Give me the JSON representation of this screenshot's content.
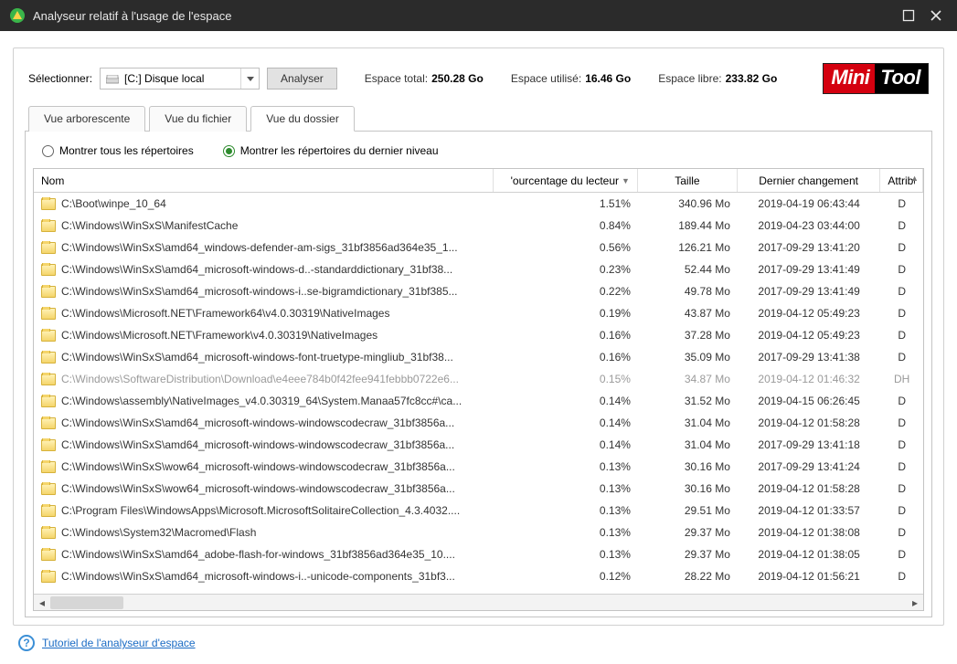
{
  "window": {
    "title": "Analyseur relatif à l'usage de l'espace"
  },
  "toolbar": {
    "select_label": "Sélectionner:",
    "drive_text": "[C:] Disque local",
    "analyze": "Analyser",
    "stats": {
      "total_label": "Espace total:",
      "total_value": "250.28 Go",
      "used_label": "Espace utilisé:",
      "used_value": "16.46 Go",
      "free_label": "Espace libre:",
      "free_value": "233.82 Go"
    },
    "logo_red": "Mini",
    "logo_black": "Tool"
  },
  "tabs": {
    "tree": "Vue arborescente",
    "file": "Vue du fichier",
    "folder": "Vue du dossier"
  },
  "radios": {
    "all": "Montrer tous les répertoires",
    "last": "Montrer les répertoires du dernier niveau"
  },
  "columns": {
    "name": "Nom",
    "pct": "'ourcentage du lecteur",
    "size": "Taille",
    "date": "Dernier changement",
    "attr": "Attribue"
  },
  "rows": [
    {
      "name": "C:\\Boot\\winpe_10_64",
      "pct": "1.51%",
      "size": "340.96 Mo",
      "date": "2019-04-19 06:43:44",
      "attr": "D"
    },
    {
      "name": "C:\\Windows\\WinSxS\\ManifestCache",
      "pct": "0.84%",
      "size": "189.44 Mo",
      "date": "2019-04-23 03:44:00",
      "attr": "D"
    },
    {
      "name": "C:\\Windows\\WinSxS\\amd64_windows-defender-am-sigs_31bf3856ad364e35_1...",
      "pct": "0.56%",
      "size": "126.21 Mo",
      "date": "2017-09-29 13:41:20",
      "attr": "D"
    },
    {
      "name": "C:\\Windows\\WinSxS\\amd64_microsoft-windows-d..-standarddictionary_31bf38...",
      "pct": "0.23%",
      "size": "52.44 Mo",
      "date": "2017-09-29 13:41:49",
      "attr": "D"
    },
    {
      "name": "C:\\Windows\\WinSxS\\amd64_microsoft-windows-i..se-bigramdictionary_31bf385...",
      "pct": "0.22%",
      "size": "49.78 Mo",
      "date": "2017-09-29 13:41:49",
      "attr": "D"
    },
    {
      "name": "C:\\Windows\\Microsoft.NET\\Framework64\\v4.0.30319\\NativeImages",
      "pct": "0.19%",
      "size": "43.87 Mo",
      "date": "2019-04-12 05:49:23",
      "attr": "D"
    },
    {
      "name": "C:\\Windows\\Microsoft.NET\\Framework\\v4.0.30319\\NativeImages",
      "pct": "0.16%",
      "size": "37.28 Mo",
      "date": "2019-04-12 05:49:23",
      "attr": "D"
    },
    {
      "name": "C:\\Windows\\WinSxS\\amd64_microsoft-windows-font-truetype-mingliub_31bf38...",
      "pct": "0.16%",
      "size": "35.09 Mo",
      "date": "2017-09-29 13:41:38",
      "attr": "D"
    },
    {
      "name": "C:\\Windows\\SoftwareDistribution\\Download\\e4eee784b0f42fee941febbb0722e6...",
      "pct": "0.15%",
      "size": "34.87 Mo",
      "date": "2019-04-12 01:46:32",
      "attr": "DH",
      "dim": true
    },
    {
      "name": "C:\\Windows\\assembly\\NativeImages_v4.0.30319_64\\System.Manaa57fc8cc#\\ca...",
      "pct": "0.14%",
      "size": "31.52 Mo",
      "date": "2019-04-15 06:26:45",
      "attr": "D"
    },
    {
      "name": "C:\\Windows\\WinSxS\\amd64_microsoft-windows-windowscodecraw_31bf3856a...",
      "pct": "0.14%",
      "size": "31.04 Mo",
      "date": "2019-04-12 01:58:28",
      "attr": "D"
    },
    {
      "name": "C:\\Windows\\WinSxS\\amd64_microsoft-windows-windowscodecraw_31bf3856a...",
      "pct": "0.14%",
      "size": "31.04 Mo",
      "date": "2017-09-29 13:41:18",
      "attr": "D"
    },
    {
      "name": "C:\\Windows\\WinSxS\\wow64_microsoft-windows-windowscodecraw_31bf3856a...",
      "pct": "0.13%",
      "size": "30.16 Mo",
      "date": "2017-09-29 13:41:24",
      "attr": "D"
    },
    {
      "name": "C:\\Windows\\WinSxS\\wow64_microsoft-windows-windowscodecraw_31bf3856a...",
      "pct": "0.13%",
      "size": "30.16 Mo",
      "date": "2019-04-12 01:58:28",
      "attr": "D"
    },
    {
      "name": "C:\\Program Files\\WindowsApps\\Microsoft.MicrosoftSolitaireCollection_4.3.4032....",
      "pct": "0.13%",
      "size": "29.51 Mo",
      "date": "2019-04-12 01:33:57",
      "attr": "D"
    },
    {
      "name": "C:\\Windows\\System32\\Macromed\\Flash",
      "pct": "0.13%",
      "size": "29.37 Mo",
      "date": "2019-04-12 01:38:08",
      "attr": "D"
    },
    {
      "name": "C:\\Windows\\WinSxS\\amd64_adobe-flash-for-windows_31bf3856ad364e35_10....",
      "pct": "0.13%",
      "size": "29.37 Mo",
      "date": "2019-04-12 01:38:05",
      "attr": "D"
    },
    {
      "name": "C:\\Windows\\WinSxS\\amd64_microsoft-windows-i..-unicode-components_31bf3...",
      "pct": "0.12%",
      "size": "28.22 Mo",
      "date": "2019-04-12 01:56:21",
      "attr": "D"
    }
  ],
  "footer": {
    "link": "Tutoriel de l'analyseur d'espace"
  }
}
